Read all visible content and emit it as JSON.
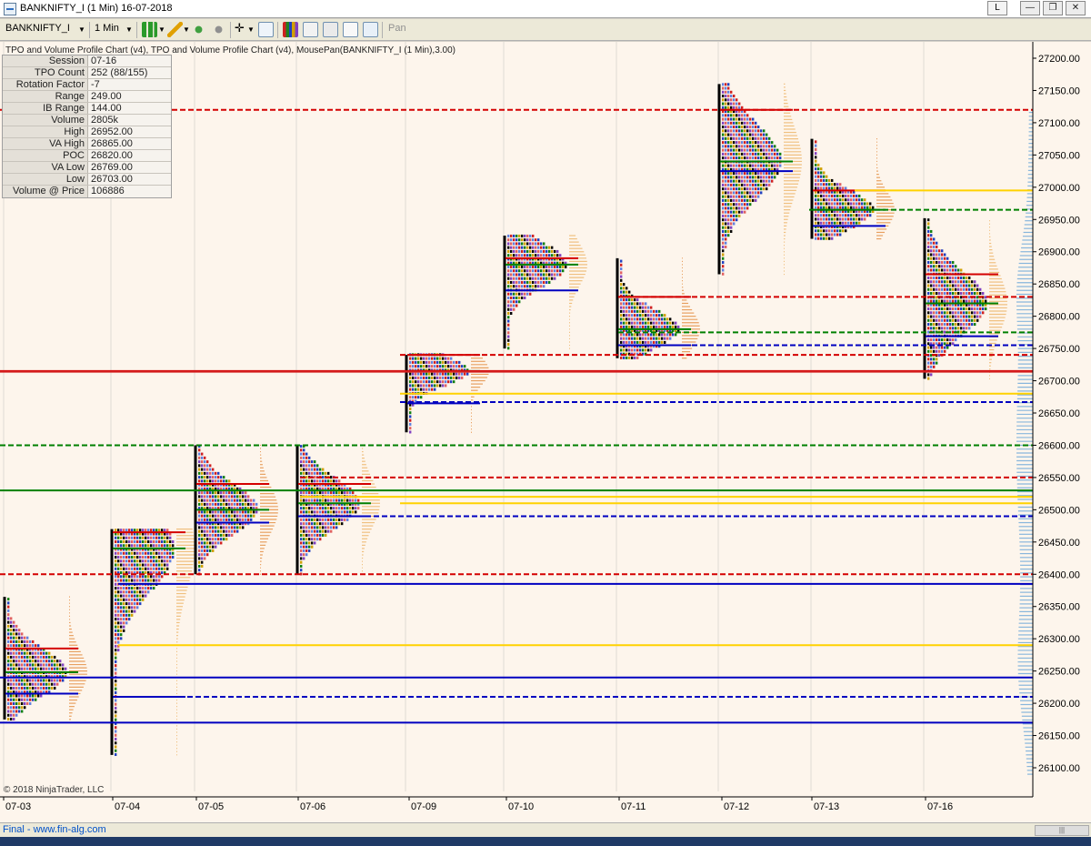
{
  "window": {
    "title": "BANKNIFTY_I (1 Min)  16-07-2018",
    "btn_l": "L",
    "btn_min": "—",
    "btn_restore": "❐",
    "btn_close": "✕"
  },
  "toolbar": {
    "instrument": "BANKNIFTY_I",
    "interval": "1 Min",
    "pan_label": "Pan"
  },
  "chart_header": "TPO and Volume Profile Chart (v4),  TPO and Volume Profile Chart (v4), MousePan(BANKNIFTY_I (1 Min),3.00)",
  "info_panel": [
    {
      "label": "Session",
      "value": "07-16"
    },
    {
      "label": "TPO Count",
      "value": "252 (88/155)"
    },
    {
      "label": "Rotation Factor",
      "value": "-7"
    },
    {
      "label": "Range",
      "value": "249.00"
    },
    {
      "label": "IB Range",
      "value": "144.00"
    },
    {
      "label": "Volume",
      "value": "2805k"
    },
    {
      "label": "High",
      "value": "26952.00"
    },
    {
      "label": "VA High",
      "value": "26865.00"
    },
    {
      "label": "POC",
      "value": "26820.00"
    },
    {
      "label": "VA Low",
      "value": "26769.00"
    },
    {
      "label": "Low",
      "value": "26703.00"
    },
    {
      "label": "Volume @ Price",
      "value": "106886"
    }
  ],
  "copyright": "© 2018 NinjaTrader, LLC",
  "status_text": "Final  -  www.fin-alg.com",
  "chart_data": {
    "type": "tpo_volume_profile",
    "y_ticks": [
      27200,
      27150,
      27100,
      27050,
      27000,
      26950,
      26900,
      26850,
      26800,
      26750,
      26700,
      26650,
      26600,
      26550,
      26500,
      26450,
      26400,
      26350,
      26300,
      26250,
      26200,
      26150,
      26100
    ],
    "ylim": [
      26070,
      27250
    ],
    "current_price": "26724.00",
    "x_labels": [
      "07-03",
      "07-04",
      "07-05",
      "07-06",
      "07-09",
      "07-10",
      "07-11",
      "07-12",
      "07-13",
      "07-16"
    ],
    "colors": {
      "current_price": "#d42020",
      "poc": "#008000",
      "va_high": "#d40000",
      "va_low": "#0000c0",
      "naked_poc": "#ffd200"
    },
    "sessions": [
      {
        "date": "07-03",
        "high": 26365,
        "low": 26175,
        "poc": 26248,
        "vah": 26285,
        "val": 26215
      },
      {
        "date": "07-04",
        "high": 26470,
        "low": 26120,
        "poc": 26440,
        "vah": 26465,
        "val": 26210
      },
      {
        "date": "07-05",
        "high": 26600,
        "low": 26400,
        "poc": 26500,
        "vah": 26540,
        "val": 26480
      },
      {
        "date": "07-06",
        "high": 26600,
        "low": 26400,
        "poc": 26510,
        "vah": 26540,
        "val": 26490
      },
      {
        "date": "07-09",
        "high": 26740,
        "low": 26620,
        "poc": 26715,
        "vah": 26740,
        "val": 26665
      },
      {
        "date": "07-10",
        "high": 26925,
        "low": 26750,
        "poc": 26880,
        "vah": 26890,
        "val": 26840
      },
      {
        "date": "07-11",
        "high": 26890,
        "low": 26735,
        "poc": 26780,
        "vah": 26830,
        "val": 26755
      },
      {
        "date": "07-12",
        "high": 27160,
        "low": 26865,
        "poc": 27040,
        "vah": 27120,
        "val": 27025
      },
      {
        "date": "07-13",
        "high": 27075,
        "low": 26920,
        "poc": 26965,
        "vah": 26995,
        "val": 26940
      },
      {
        "date": "07-16",
        "high": 26952,
        "low": 26703,
        "poc": 26820,
        "vah": 26865,
        "val": 26769
      }
    ],
    "levels": [
      {
        "price": 27120,
        "color": "#d40000",
        "dash": true
      },
      {
        "price": 26995,
        "color": "#ffd200",
        "dash": false
      },
      {
        "price": 26965,
        "color": "#008000",
        "dash": true
      },
      {
        "price": 26830,
        "color": "#d40000",
        "dash": true
      },
      {
        "price": 26775,
        "color": "#008000",
        "dash": true
      },
      {
        "price": 26755,
        "color": "#0000c0",
        "dash": true
      },
      {
        "price": 26740,
        "color": "#d40000",
        "dash": true
      },
      {
        "price": 26715,
        "color": "#d40000",
        "dash": false
      },
      {
        "price": 26680,
        "color": "#ffd200",
        "dash": false
      },
      {
        "price": 26667,
        "color": "#0000c0",
        "dash": true
      },
      {
        "price": 26600,
        "color": "#008000",
        "dash": true
      },
      {
        "price": 26550,
        "color": "#d40000",
        "dash": true
      },
      {
        "price": 26530,
        "color": "#008000",
        "dash": false
      },
      {
        "price": 26520,
        "color": "#ffd200",
        "dash": false
      },
      {
        "price": 26510,
        "color": "#ffd200",
        "dash": false
      },
      {
        "price": 26490,
        "color": "#0000c0",
        "dash": true
      },
      {
        "price": 26400,
        "color": "#d40000",
        "dash": true
      },
      {
        "price": 26385,
        "color": "#0000c0",
        "dash": false
      },
      {
        "price": 26290,
        "color": "#ffd200",
        "dash": false
      },
      {
        "price": 26240,
        "color": "#0000c0",
        "dash": false
      },
      {
        "price": 26210,
        "color": "#0000c0",
        "dash": true
      },
      {
        "price": 26170,
        "color": "#0000c0",
        "dash": false
      }
    ]
  }
}
